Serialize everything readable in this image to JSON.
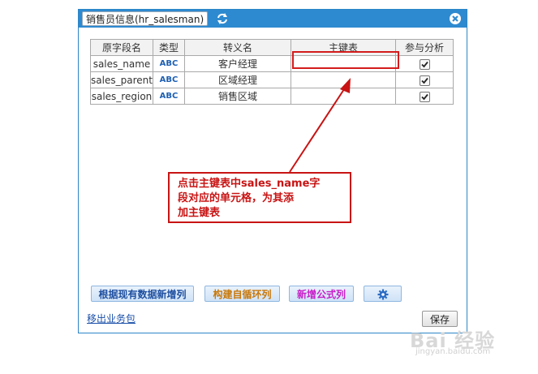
{
  "dialog": {
    "title": "销售员信息(hr_salesman)",
    "refresh_icon": "refresh-icon",
    "close_icon": "close-icon"
  },
  "table": {
    "headers": [
      "原字段名",
      "类型",
      "转义名",
      "主键表",
      "参与分析"
    ],
    "rows": [
      {
        "field": "sales_name",
        "type": "ABC",
        "alias": "客户经理",
        "pk_table": "",
        "analyze": true
      },
      {
        "field": "sales_parent",
        "type": "ABC",
        "alias": "区域经理",
        "pk_table": "",
        "analyze": true
      },
      {
        "field": "sales_region",
        "type": "ABC",
        "alias": "销售区域",
        "pk_table": "",
        "analyze": true
      }
    ]
  },
  "buttons": {
    "add_from_data": "根据现有数据新增列",
    "build_loop": "构建自循环列",
    "add_formula": "新增公式列",
    "settings_icon": "gear-icon",
    "save": "保存"
  },
  "links": {
    "remove_package": "移出业务包"
  },
  "annotation": {
    "line1": "点击主键表中sales_name字",
    "line2": "段对应的单元格，为其添",
    "line3": "加主键表"
  },
  "watermark": {
    "brand": "Bai 经验",
    "url": "jingyan.baidu.com"
  },
  "colors": {
    "titlebar": "#2e8ad0",
    "annotation": "#c81414",
    "build_loop_text": "#c8780a",
    "add_formula_text": "#c81ec8",
    "add_from_data_text": "#1e4fa0"
  }
}
